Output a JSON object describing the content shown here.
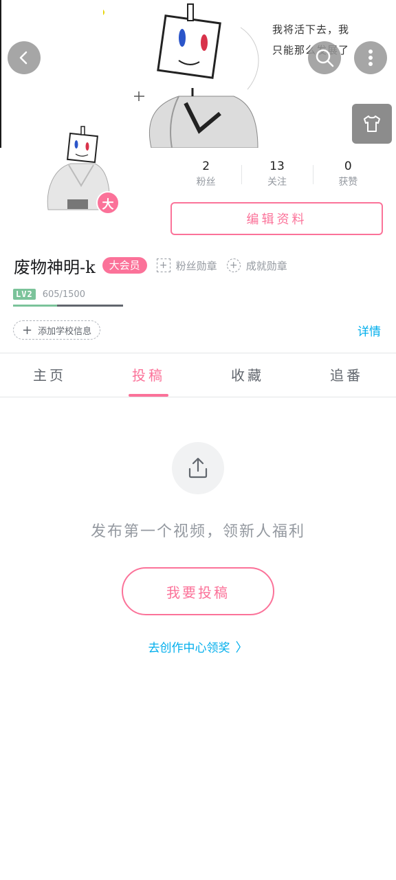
{
  "banner": {
    "caption_line1": "我将活下去，我",
    "caption_line2": "只能那么发展了"
  },
  "header": {
    "back_icon": "chevron-left-icon",
    "search_icon": "search-icon",
    "more_icon": "more-vertical-icon",
    "dress_icon": "tshirt-icon"
  },
  "profile": {
    "vip_badge": "大",
    "stats": [
      {
        "value": "2",
        "label": "粉丝"
      },
      {
        "value": "13",
        "label": "关注"
      },
      {
        "value": "0",
        "label": "获赞"
      }
    ],
    "edit_button": "编辑资料",
    "name": "废物神明-k",
    "member_tag": "大会员",
    "fan_medal": "粉丝勋章",
    "achievement_medal": "成就勋章",
    "level": "LV2",
    "exp_text": "605/1500",
    "exp_progress": 0.403,
    "school_button": "添加学校信息",
    "detail_link": "详情"
  },
  "tabs": [
    {
      "label": "主页",
      "active": false
    },
    {
      "label": "投稿",
      "active": true
    },
    {
      "label": "收藏",
      "active": false
    },
    {
      "label": "追番",
      "active": false
    }
  ],
  "empty_state": {
    "icon": "upload-icon",
    "hint": "发布第一个视频，领新人福利",
    "post_button": "我要投稿",
    "creator_link": "去创作中心领奖"
  },
  "colors": {
    "accent_pink": "#fb7299",
    "link_blue": "#00aeec",
    "level_green": "#7bc39a"
  }
}
